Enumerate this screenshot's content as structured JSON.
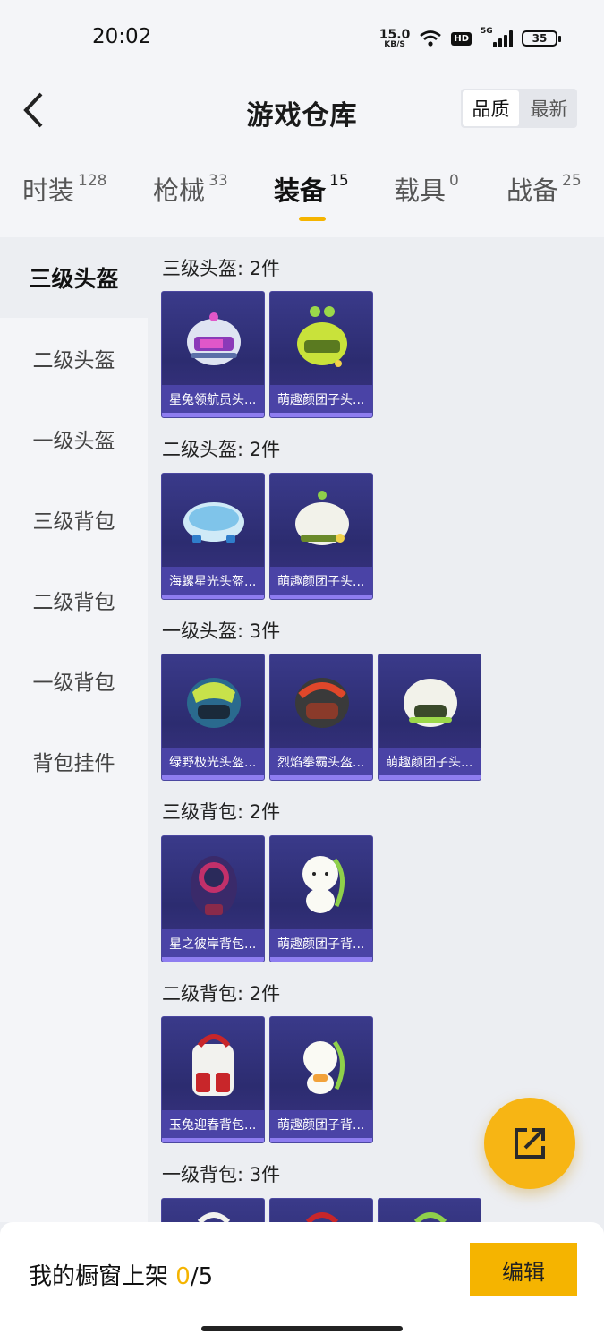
{
  "status_bar": {
    "time": "20:02",
    "net_speed": "15.0",
    "net_unit": "KB/S",
    "hd": "HD",
    "network": "5G",
    "battery": "35"
  },
  "header": {
    "title": "游戏仓库",
    "sort_quality": "品质",
    "sort_newest": "最新"
  },
  "tabs": [
    {
      "label": "时装",
      "count": "128"
    },
    {
      "label": "枪械",
      "count": "33"
    },
    {
      "label": "装备",
      "count": "15"
    },
    {
      "label": "载具",
      "count": "0"
    },
    {
      "label": "战备",
      "count": "25"
    }
  ],
  "sidebar": [
    "三级头盔",
    "二级头盔",
    "一级头盔",
    "三级背包",
    "二级背包",
    "一级背包",
    "背包挂件"
  ],
  "sections": [
    {
      "title": "三级头盔: 2件",
      "items": [
        "星兔领航员头...",
        "萌趣颜团子头..."
      ]
    },
    {
      "title": "二级头盔: 2件",
      "items": [
        "海螺星光头盔...",
        "萌趣颜团子头..."
      ]
    },
    {
      "title": "一级头盔: 3件",
      "items": [
        "绿野极光头盔...",
        "烈焰拳霸头盔...",
        "萌趣颜团子头..."
      ]
    },
    {
      "title": "三级背包: 2件",
      "items": [
        "星之彼岸背包...",
        "萌趣颜团子背..."
      ]
    },
    {
      "title": "二级背包: 2件",
      "items": [
        "玉兔迎春背包...",
        "萌趣颜团子背..."
      ]
    },
    {
      "title": "一级背包: 3件",
      "items": [
        "",
        "",
        ""
      ]
    }
  ],
  "bottom": {
    "label": "我的橱窗上架 ",
    "current": "0",
    "total": "/5",
    "edit": "编辑"
  },
  "colors": {
    "accent": "#f5b400",
    "card": "#2c2c70"
  }
}
